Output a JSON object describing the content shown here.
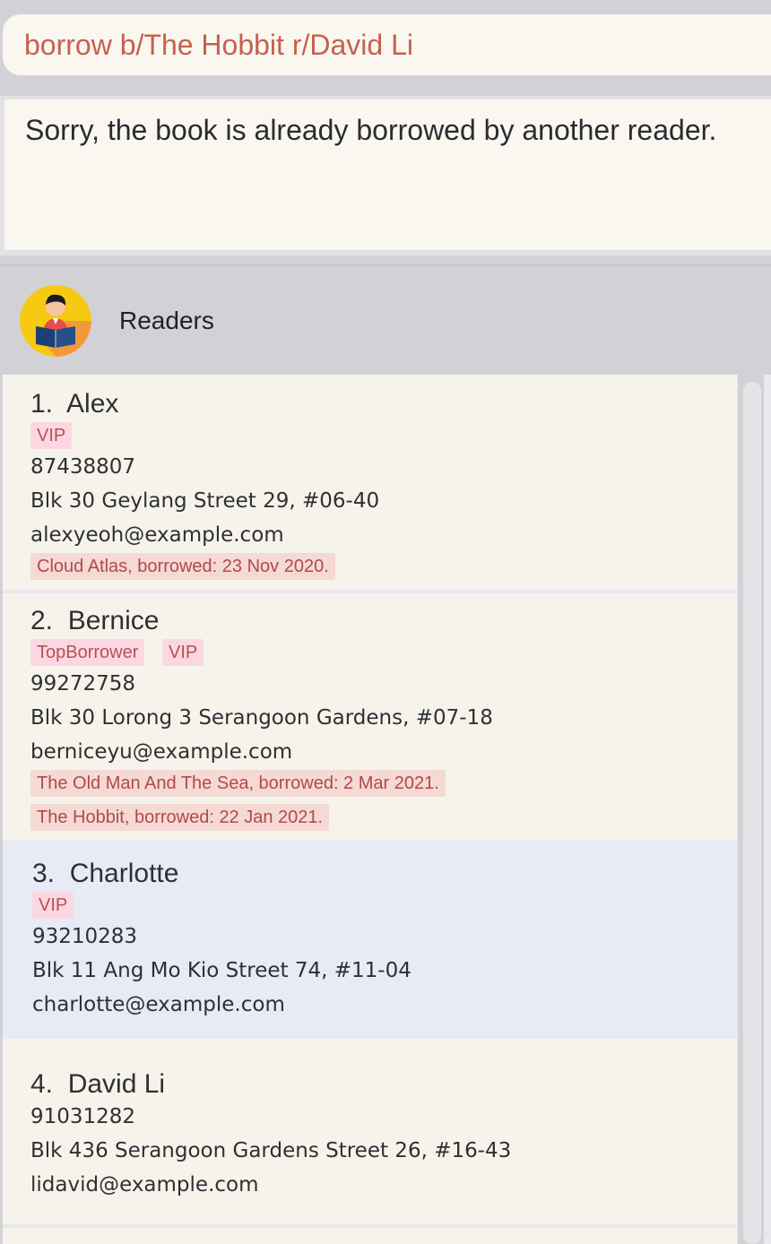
{
  "command": {
    "value": "borrow b/The Hobbit r/David Li"
  },
  "result": {
    "text": "Sorry, the book is already borrowed by another reader."
  },
  "panel": {
    "title": "Readers",
    "icon": "reader-avatar-icon"
  },
  "readers": [
    {
      "index": "1.",
      "name": "Alex",
      "tags": [
        "VIP"
      ],
      "phone": "87438807",
      "address": "Blk 30 Geylang Street 29, #06-40",
      "email": "alexyeoh@example.com",
      "loans": [
        "Cloud Atlas, borrowed: 23 Nov 2020."
      ]
    },
    {
      "index": "2.",
      "name": "Bernice",
      "tags": [
        "TopBorrower",
        "VIP"
      ],
      "phone": "99272758",
      "address": "Blk 30 Lorong 3 Serangoon Gardens, #07-18",
      "email": "berniceyu@example.com",
      "loans": [
        "The Old Man And The Sea, borrowed: 2 Mar 2021.",
        "The Hobbit, borrowed: 22 Jan 2021."
      ]
    },
    {
      "index": "3.",
      "name": "Charlotte",
      "tags": [
        "VIP"
      ],
      "phone": "93210283",
      "address": "Blk 11 Ang Mo Kio Street 74, #11-04",
      "email": "charlotte@example.com",
      "loans": []
    },
    {
      "index": "4.",
      "name": "David Li",
      "tags": [],
      "phone": "91031282",
      "address": "Blk 436 Serangoon Gardens Street 26, #16-43",
      "email": "lidavid@example.com",
      "loans": []
    }
  ],
  "colors": {
    "command_text": "#c8604c",
    "tag_bg": "#fbd8e1",
    "loan_bg": "#f4d9d4",
    "selected_bg": "#e8eaf5"
  }
}
